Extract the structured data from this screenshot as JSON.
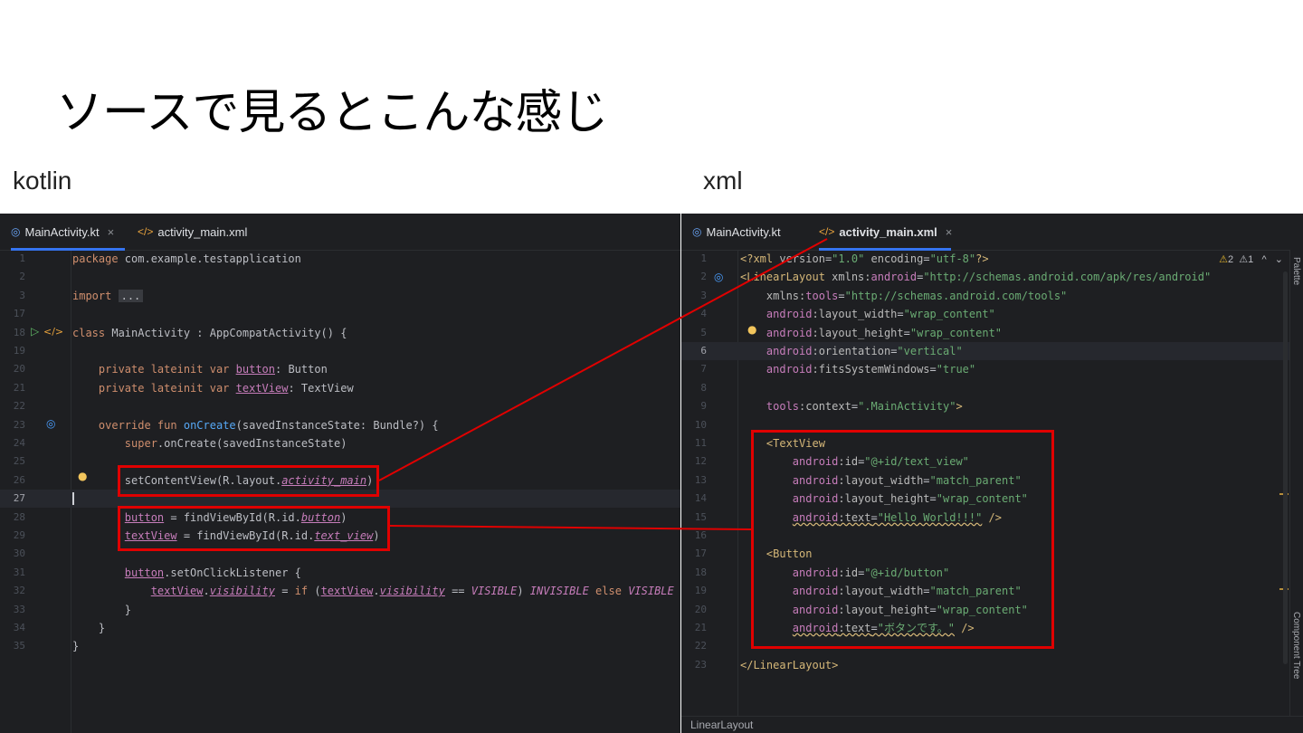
{
  "slide": {
    "title": "ソースで見るとこんな感じ",
    "left_label": "kotlin",
    "right_label": "xml"
  },
  "colors": {
    "editor_bg": "#1e1f22",
    "highlight_red": "#e00000",
    "accent_blue": "#3574f0",
    "keyword": "#cf8e6d",
    "string": "#6aab73",
    "tag": "#d5b778",
    "property": "#c77dbb"
  },
  "kotlin_editor": {
    "tabs": [
      {
        "label": "MainActivity.kt",
        "icon": "kotlin-class-icon",
        "active": true,
        "close": "×"
      },
      {
        "label": "activity_main.xml",
        "icon": "xml-tag-icon",
        "active": false
      }
    ],
    "gutter_icons": {
      "run": "▷",
      "xml_link": "</>",
      "override": "◎",
      "bulb": "💡"
    },
    "lines": [
      {
        "n": "1"
      },
      {
        "n": "2"
      },
      {
        "n": "3"
      },
      {
        "n": "17"
      },
      {
        "n": "18"
      },
      {
        "n": "19"
      },
      {
        "n": "20"
      },
      {
        "n": "21"
      },
      {
        "n": "22"
      },
      {
        "n": "23"
      },
      {
        "n": "24"
      },
      {
        "n": "25"
      },
      {
        "n": "26"
      },
      {
        "n": "27"
      },
      {
        "n": "28"
      },
      {
        "n": "29"
      },
      {
        "n": "30"
      },
      {
        "n": "31"
      },
      {
        "n": "32"
      },
      {
        "n": "33"
      },
      {
        "n": "34"
      },
      {
        "n": "35"
      }
    ],
    "code": {
      "l1_kw": "package",
      "l1_rest": " com.example.testapplication",
      "l3_kw": "import",
      "l3_fold": "...",
      "l18_kw": "class",
      "l18_rest": " MainActivity : AppCompatActivity() {",
      "l20_kw": "private lateinit var",
      "l20_prop": "button",
      "l20_rest": ": Button",
      "l21_kw": "private lateinit var",
      "l21_prop": "textView",
      "l21_rest": ": TextView",
      "l23_kw": "override fun",
      "l23_fn": "onCreate",
      "l23_rest": "(savedInstanceState: Bundle?) {",
      "l24_kw": "super",
      "l24_rest": ".onCreate(savedInstanceState)",
      "l26_pre": "setContentView(R.layout.",
      "l26_prop": "activity_main",
      "l26_post": ")",
      "l28_prop": "button",
      "l28_mid": " = findViewById(R.id.",
      "l28_prop2": "button",
      "l28_post": ")",
      "l29_prop": "textView",
      "l29_mid": " = findViewById(R.id.",
      "l29_prop2": "text_view",
      "l29_post": ")",
      "l31_prop": "button",
      "l31_rest": ".setOnClickListener {",
      "l32_prop": "textView",
      "l32_dot": ".",
      "l32_prop2": "visibility",
      "l32_eq": " = ",
      "l32_if": "if",
      "l32_open": " (",
      "l32_prop3": "textView",
      "l32_dot2": ".",
      "l32_prop4": "visibility",
      "l32_cmp": " == ",
      "l32_vis": "VISIBLE",
      "l32_close": ") ",
      "l32_invis": "INVISIBLE",
      "l32_else": " else ",
      "l32_vis2": "VISIBLE",
      "l33": "}",
      "l34": "}",
      "l35": "}"
    }
  },
  "xml_editor": {
    "tabs": [
      {
        "label": "MainActivity.kt",
        "icon": "kotlin-class-icon",
        "active": false
      },
      {
        "label": "activity_main.xml",
        "icon": "xml-tag-icon",
        "active": true,
        "close": "×"
      }
    ],
    "inspection": {
      "warnings": "2",
      "weak_warnings": "1",
      "up": "^",
      "down": "⌄"
    },
    "side_tabs": {
      "palette": "Palette",
      "component_tree": "Component Tree"
    },
    "status": "LinearLayout",
    "lines": [
      {
        "n": "1"
      },
      {
        "n": "2"
      },
      {
        "n": "3"
      },
      {
        "n": "4"
      },
      {
        "n": "5"
      },
      {
        "n": "6"
      },
      {
        "n": "7"
      },
      {
        "n": "8"
      },
      {
        "n": "9"
      },
      {
        "n": "10"
      },
      {
        "n": "11"
      },
      {
        "n": "12"
      },
      {
        "n": "13"
      },
      {
        "n": "14"
      },
      {
        "n": "15"
      },
      {
        "n": "16"
      },
      {
        "n": "17"
      },
      {
        "n": "18"
      },
      {
        "n": "19"
      },
      {
        "n": "20"
      },
      {
        "n": "21"
      },
      {
        "n": "22"
      },
      {
        "n": "23"
      }
    ],
    "code": {
      "l1_a": "<?xml ",
      "l1_b": "version",
      "l1_c": "=",
      "l1_d": "\"1.0\"",
      "l1_e": " encoding",
      "l1_f": "=",
      "l1_g": "\"utf-8\"",
      "l1_h": "?>",
      "l2_tag": "<LinearLayout",
      "l2_sp": " xmlns:",
      "l2_ns": "android",
      "l2_eq": "=",
      "l2_str": "\"http://schemas.android.com/apk/res/android\"",
      "l3_a": "xmlns:",
      "l3_ns": "tools",
      "l3_eq": "=",
      "l3_str": "\"http://schemas.android.com/tools\"",
      "l4_ns": "android",
      "l4_at": ":layout_width",
      "l4_eq": "=",
      "l4_str": "\"wrap_content\"",
      "l5_ns": "android",
      "l5_at": ":layout_height",
      "l5_eq": "=",
      "l5_str": "\"wrap_content\"",
      "l6_ns": "android",
      "l6_at": ":orientation",
      "l6_eq": "=",
      "l6_str": "\"vertical\"",
      "l7_ns": "android",
      "l7_at": ":fitsSystemWindows",
      "l7_eq": "=",
      "l7_str": "\"true\"",
      "l9_ns": "tools",
      "l9_at": ":context",
      "l9_eq": "=",
      "l9_str": "\".MainActivity\"",
      "l9_end": ">",
      "l11_tag": "<TextView",
      "l12_ns": "android",
      "l12_at": ":id",
      "l12_eq": "=",
      "l12_str": "\"@+id/text_view\"",
      "l13_ns": "android",
      "l13_at": ":layout_width",
      "l13_eq": "=",
      "l13_str": "\"match_parent\"",
      "l14_ns": "android",
      "l14_at": ":layout_height",
      "l14_eq": "=",
      "l14_str": "\"wrap_content\"",
      "l15_ns": "android",
      "l15_at": ":text",
      "l15_eq": "=",
      "l15_str": "\"Hello World!!!\"",
      "l15_end": " />",
      "l17_tag": "<Button",
      "l18_ns": "android",
      "l18_at": ":id",
      "l18_eq": "=",
      "l18_str": "\"@+id/button\"",
      "l19_ns": "android",
      "l19_at": ":layout_width",
      "l19_eq": "=",
      "l19_str": "\"match_parent\"",
      "l20_ns": "android",
      "l20_at": ":layout_height",
      "l20_eq": "=",
      "l20_str": "\"wrap_content\"",
      "l21_ns": "android",
      "l21_at": ":text",
      "l21_eq": "=",
      "l21_str": "\"ボタンです。\"",
      "l21_end": " />",
      "l23_tag": "</LinearLayout>"
    }
  }
}
